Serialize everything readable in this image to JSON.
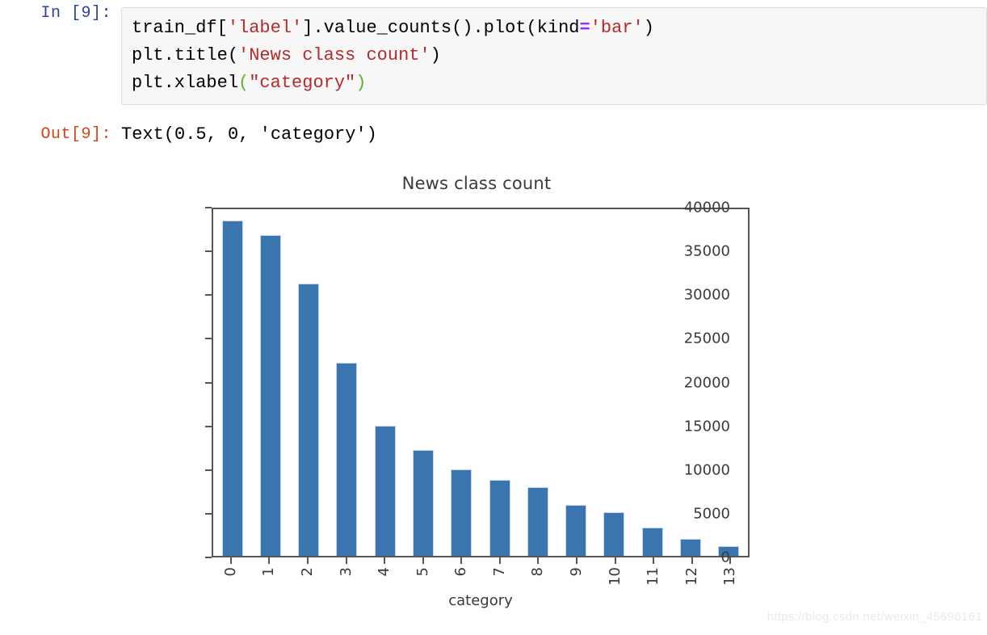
{
  "notebook": {
    "in_prompt": "In [9]:",
    "out_prompt": "Out[9]:",
    "code_lines": [
      [
        {
          "t": "plain",
          "s": "train_df["
        },
        {
          "t": "str",
          "s": "'label'"
        },
        {
          "t": "plain",
          "s": "].value_counts().plot(kind"
        },
        {
          "t": "op",
          "s": "="
        },
        {
          "t": "str",
          "s": "'bar'"
        },
        {
          "t": "plain",
          "s": ")"
        }
      ],
      [
        {
          "t": "plain",
          "s": "plt.title("
        },
        {
          "t": "str",
          "s": "'News class count'"
        },
        {
          "t": "plain",
          "s": ")"
        }
      ],
      [
        {
          "t": "plain",
          "s": "plt.xlabel"
        },
        {
          "t": "paren",
          "s": "("
        },
        {
          "t": "str",
          "s": "\"category\""
        },
        {
          "t": "paren",
          "s": ")"
        }
      ]
    ],
    "out_value": "Text(0.5, 0, 'category')"
  },
  "watermark": "https://blog.csdn.net/weixin_45696161",
  "colors": {
    "bar": "#3b75af",
    "in_prompt": "#303f9f",
    "out_prompt": "#d84315",
    "string": "#b52a2a",
    "operator": "#aa22ff",
    "paren": "#5fae2f",
    "axis": "#555555",
    "text": "#3a3a3a",
    "cell_bg": "#f7f7f7"
  },
  "chart_data": {
    "type": "bar",
    "title": "News class count",
    "xlabel": "category",
    "ylabel": "",
    "categories": [
      "0",
      "1",
      "2",
      "3",
      "4",
      "5",
      "6",
      "7",
      "8",
      "9",
      "10",
      "11",
      "12",
      "13"
    ],
    "values": [
      38700,
      37000,
      31400,
      22300,
      15000,
      12200,
      10000,
      8800,
      7900,
      5900,
      5000,
      3300,
      2000,
      1100
    ],
    "ylim": [
      0,
      40000
    ],
    "yticks": [
      0,
      5000,
      10000,
      15000,
      20000,
      25000,
      30000,
      35000,
      40000
    ],
    "ytick_labels": [
      "0",
      "5000",
      "10000",
      "15000",
      "20000",
      "25000",
      "30000",
      "35000",
      "40000"
    ],
    "grid": false,
    "legend": false,
    "xtick_rotation": 90
  }
}
